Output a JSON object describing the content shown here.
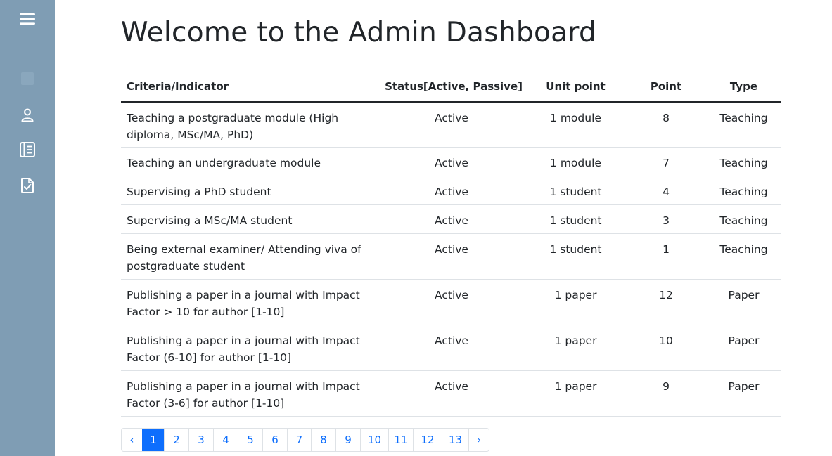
{
  "sidebar": {
    "icons": [
      "menu-icon",
      "dashboard-icon",
      "user-icon",
      "list-book-icon",
      "file-check-icon"
    ],
    "background": "#7f9db4"
  },
  "page": {
    "title": "Welcome to the Admin Dashboard"
  },
  "table": {
    "headers": [
      "Criteria/Indicator",
      "Status[Active, Passive]",
      "Unit point",
      "Point",
      "Type"
    ],
    "rows": [
      [
        "Teaching a postgraduate module (High diploma, MSc/MA, PhD)",
        "Active",
        "1 module",
        "8",
        "Teaching"
      ],
      [
        "Teaching an undergraduate module",
        "Active",
        "1 module",
        "7",
        "Teaching"
      ],
      [
        "Supervising a PhD student",
        "Active",
        "1 student",
        "4",
        "Teaching"
      ],
      [
        "Supervising a MSc/MA student",
        "Active",
        "1 student",
        "3",
        "Teaching"
      ],
      [
        "Being external examiner/ Attending viva of postgraduate student",
        "Active",
        "1 student",
        "1",
        "Teaching"
      ],
      [
        "Publishing a paper in a journal with Impact Factor > 10 for author [1-10]",
        "Active",
        "1 paper",
        "12",
        "Paper"
      ],
      [
        "Publishing a paper in a journal with Impact Factor (6-10] for author [1-10]",
        "Active",
        "1 paper",
        "10",
        "Paper"
      ],
      [
        "Publishing a paper in a journal with Impact Factor (3-6] for author [1-10]",
        "Active",
        "1 paper",
        "9",
        "Paper"
      ]
    ]
  },
  "pagination": {
    "prev": "‹",
    "pages": [
      "1",
      "2",
      "3",
      "4",
      "5",
      "6",
      "7",
      "8",
      "9",
      "10",
      "11",
      "12",
      "13"
    ],
    "next": "›",
    "active_page": "1",
    "accent": "#0d6efd"
  }
}
